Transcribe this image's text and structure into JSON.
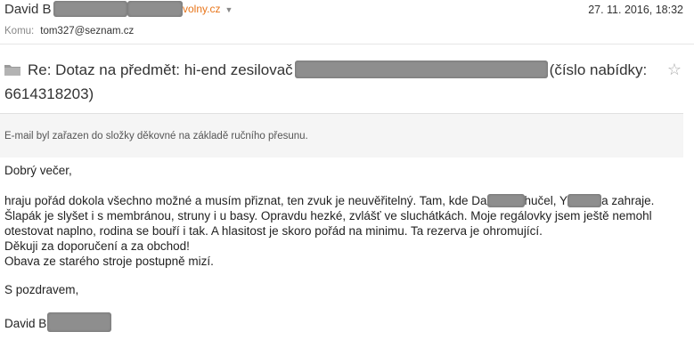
{
  "header": {
    "sender_name": "David B",
    "sender_domain": "volny.cz",
    "date": "27. 11. 2016, 18:32",
    "to_label": "Komu:",
    "to_value": "tom327@seznam.cz"
  },
  "subject": {
    "prefix": "Re: Dotaz na předmět: hi-end zesilovač",
    "suffix": "(číslo nabídky:",
    "number": "6614318203)"
  },
  "notice": "E-mail byl zařazen do složky děkovné na základě ručního přesunu.",
  "body": {
    "greeting": "Dobrý večer,",
    "line1_a": "hraju pořád dokola všechno možné a musím přiznat, ten zvuk je neuvěřitelný. Tam, kde Da",
    "line1_b": "hučel, Y",
    "line1_c": "a zahraje.",
    "line2": "Šlapák je slyšet i s membránou, struny i u basy. Opravdu hezké, zvlášť ve sluchátkách. Moje regálovky jsem ještě nemohl",
    "line3": "otestovat naplno, rodina se bouří i tak. A hlasitost je skoro pořád na minimu. Ta rezerva je ohromující.",
    "line4": "Děkuji za doporučení a za obchod!",
    "line5": "Obava ze starého stroje postupně mizí.",
    "closing": "S pozdravem,",
    "signature": "David B"
  },
  "colors": {
    "domain_orange": "#e8751a",
    "notice_bg": "#f5f5f5"
  },
  "icons": {
    "folder": "folder-icon",
    "star": "star-icon",
    "caret": "chevron-down-icon"
  }
}
